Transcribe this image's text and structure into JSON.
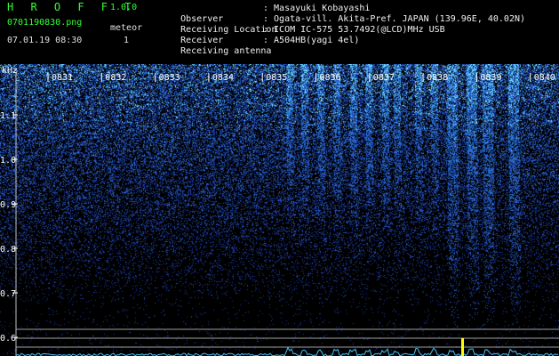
{
  "header": {
    "title": "H R O F F T",
    "version": "1.0.0",
    "filename": "0701190830.png",
    "meteor_label": "meteor",
    "datetime": "07.01.19 08:30",
    "meteor_count": "1"
  },
  "info": [
    {
      "label": "Observer",
      "value": ": Masayuki Kobayashi"
    },
    {
      "label": "Receiving Location",
      "value": ": Ogata-vill. Akita-Pref. JAPAN (139.96E, 40.02N)"
    },
    {
      "label": "Receiver",
      "value": ": ICOM IC-575 53.7492(@LCD)MHz USB"
    },
    {
      "label": "Receiving antenna",
      "value": ": A504HB(yagi 4el)"
    }
  ],
  "spectrogram": {
    "unit": "kHz",
    "time_labels": [
      "0831",
      "0832",
      "0833",
      "0834",
      "0835",
      "0836",
      "0837",
      "0838",
      "0839",
      "0840"
    ],
    "freq_labels": [
      "1.1",
      "1.0",
      "0.9",
      "0.8",
      "0.7",
      "0.6"
    ],
    "colors": {
      "background": "#000000",
      "noise": "#1a3ad8",
      "signal": "#40e0ff",
      "marker": "#ffff00"
    }
  }
}
